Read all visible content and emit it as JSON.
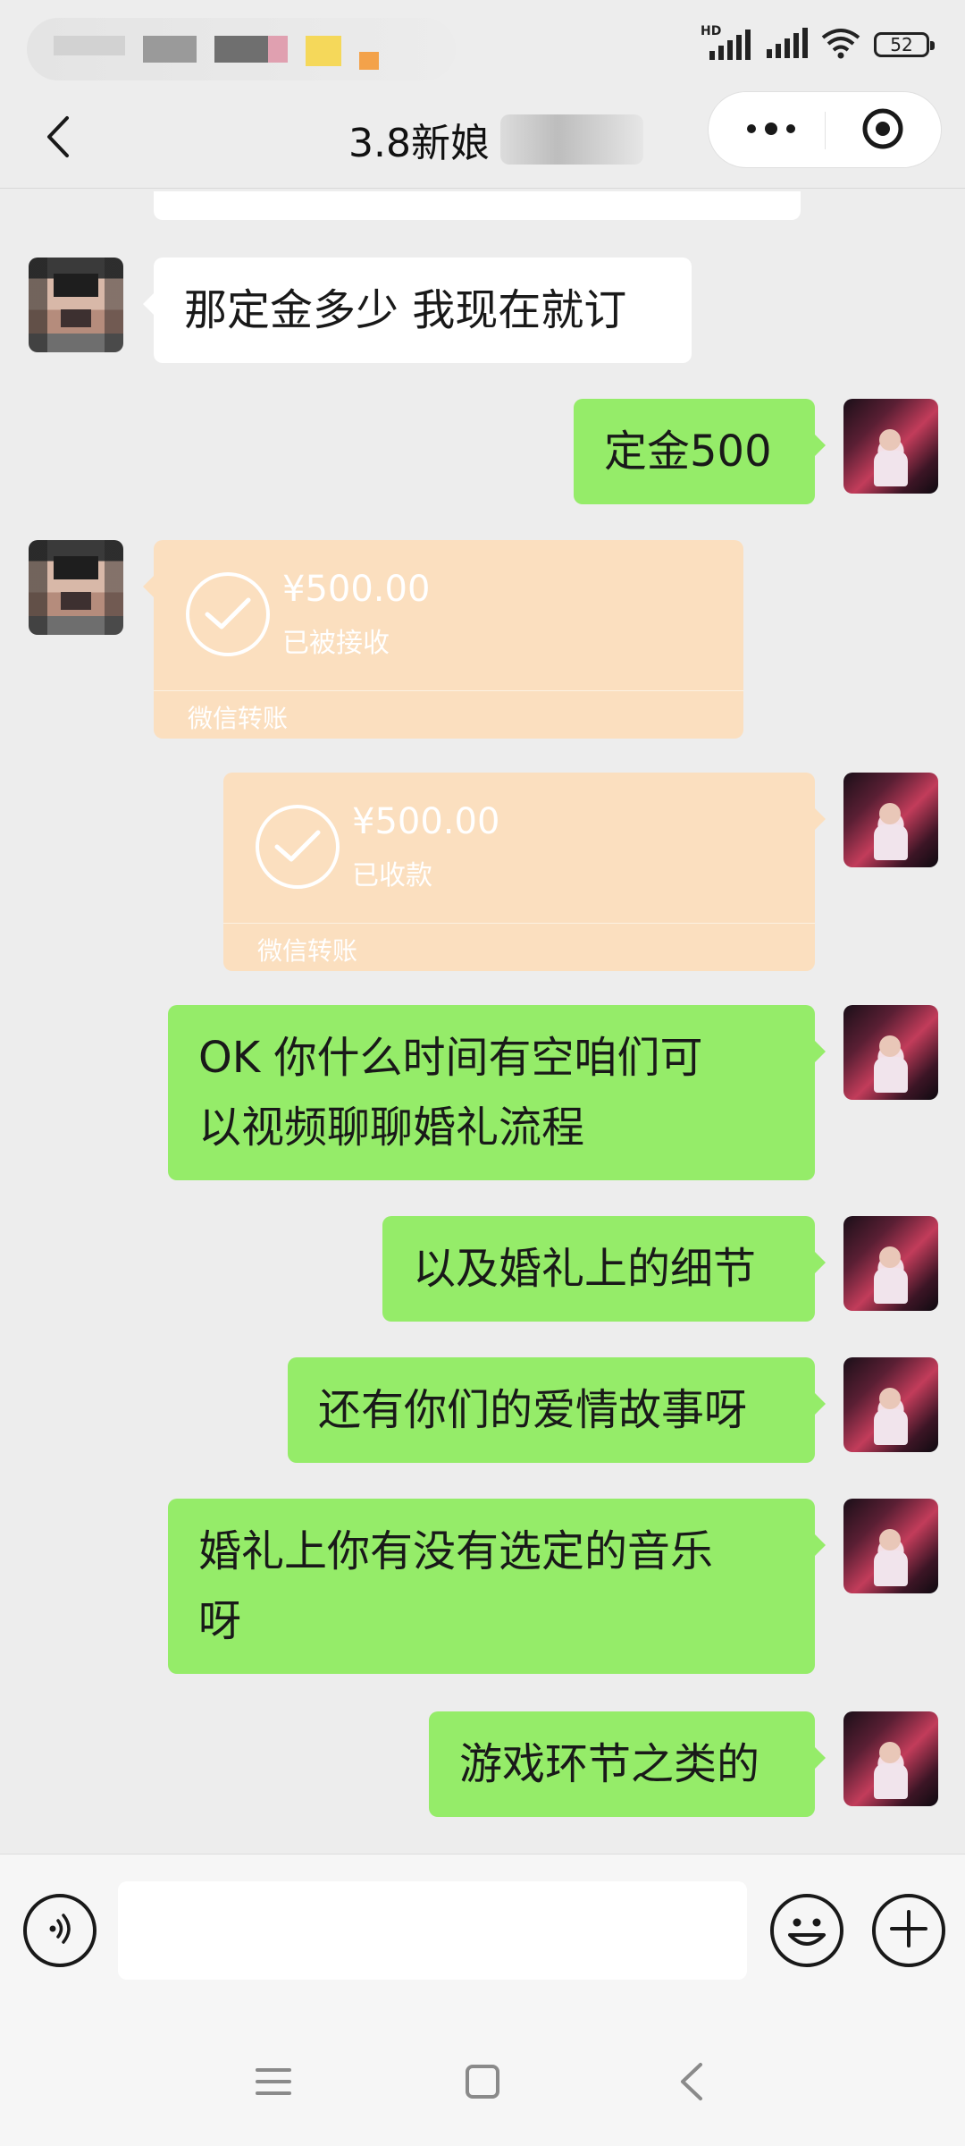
{
  "status_bar": {
    "network_label": "HD",
    "battery_level": "52",
    "icons": [
      "signal-icon",
      "signal-icon",
      "wifi-icon",
      "battery-icon"
    ]
  },
  "header": {
    "title": "3.8新娘",
    "back_icon": "chevron-left-icon",
    "more_icon": "more-dots-icon",
    "close_icon": "target-close-icon"
  },
  "messages": [
    {
      "side": "left",
      "type": "text",
      "text": "那定金多少 我现在就订"
    },
    {
      "side": "right",
      "type": "text",
      "text": "定金500"
    },
    {
      "side": "left",
      "type": "transfer",
      "amount": "¥500.00",
      "status": "已被接收",
      "label": "微信转账"
    },
    {
      "side": "right",
      "type": "transfer",
      "amount": "¥500.00",
      "status": "已收款",
      "label": "微信转账"
    },
    {
      "side": "right",
      "type": "text",
      "lines": [
        "OK 你什么时间有空咱们可",
        "以视频聊聊婚礼流程"
      ]
    },
    {
      "side": "right",
      "type": "text",
      "text": "以及婚礼上的细节"
    },
    {
      "side": "right",
      "type": "text",
      "text": "还有你们的爱情故事呀"
    },
    {
      "side": "right",
      "type": "text",
      "lines": [
        "婚礼上你有没有选定的音乐",
        "呀"
      ]
    },
    {
      "side": "right",
      "type": "text",
      "text": "游戏环节之类的"
    }
  ],
  "input_bar": {
    "value": "",
    "voice_icon": "voice-icon",
    "emoji_icon": "emoji-icon",
    "plus_icon": "plus-icon"
  },
  "nav_bar": {
    "icons": [
      "menu-icon",
      "home-icon",
      "back-icon"
    ]
  },
  "colors": {
    "background": "#ededed",
    "self_bubble": "#95ec69",
    "other_bubble": "#ffffff",
    "transfer_card": "#fbdfbf"
  }
}
